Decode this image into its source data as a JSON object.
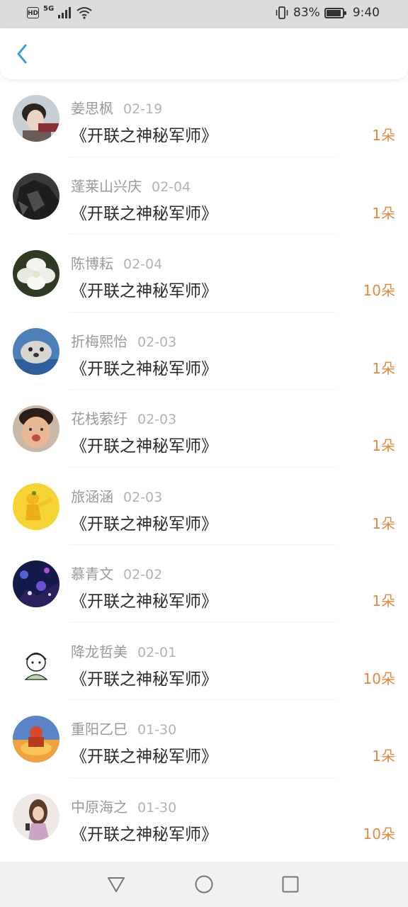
{
  "status_bar": {
    "network": "5G",
    "battery": "83%",
    "time": "9:40"
  },
  "header": {
    "back_icon": "chevron-left-icon",
    "accent_color": "#3aa1d8"
  },
  "list": {
    "count_color": "#e8873e",
    "items": [
      {
        "name": "姜思枫",
        "date": "02-19",
        "title": "《开联之神秘军师》",
        "count": "1朵",
        "avatar": "photo-young-man"
      },
      {
        "name": "蓬莱山兴庆",
        "date": "02-04",
        "title": "《开联之神秘军师》",
        "count": "1朵",
        "avatar": "photo-leather-jacket"
      },
      {
        "name": "陈博耘",
        "date": "02-04",
        "title": "《开联之神秘军师》",
        "count": "10朵",
        "avatar": "photo-white-flower"
      },
      {
        "name": "折梅熙怡",
        "date": "02-03",
        "title": "《开联之神秘军师》",
        "count": "1朵",
        "avatar": "photo-seal"
      },
      {
        "name": "花栈萦纡",
        "date": "02-03",
        "title": "《开联之神秘军师》",
        "count": "1朵",
        "avatar": "photo-child-face"
      },
      {
        "name": "旅涵涵",
        "date": "02-03",
        "title": "《开联之神秘军师》",
        "count": "1朵",
        "avatar": "photo-yellow-figure"
      },
      {
        "name": "慕青文",
        "date": "02-02",
        "title": "《开联之神秘军师》",
        "count": "1朵",
        "avatar": "photo-night-lights"
      },
      {
        "name": "降龙哲美",
        "date": "02-01",
        "title": "《开联之神秘军师》",
        "count": "10朵",
        "avatar": "cartoon-boy"
      },
      {
        "name": "重阳乙巳",
        "date": "01-30",
        "title": "《开联之神秘军师》",
        "count": "1朵",
        "avatar": "photo-sunset-figure"
      },
      {
        "name": "中原海之",
        "date": "01-30",
        "title": "《开联之神秘军师》",
        "count": "10朵",
        "avatar": "photo-woman-phone"
      }
    ]
  },
  "nav_bar": {
    "back": "triangle-back-icon",
    "home": "circle-home-icon",
    "recent": "square-recent-icon"
  }
}
